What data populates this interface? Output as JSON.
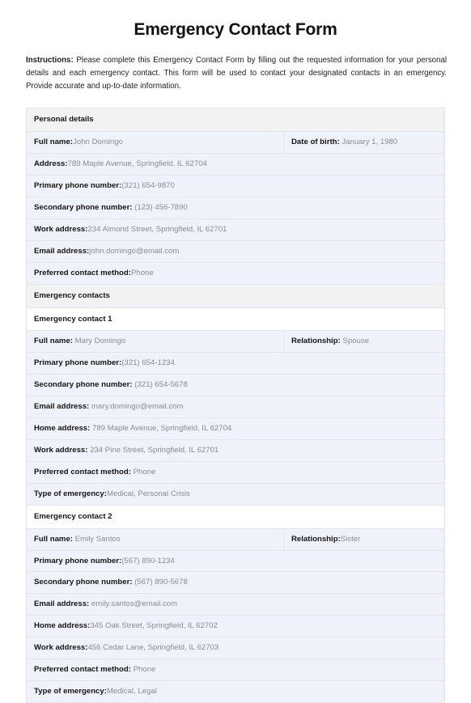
{
  "document": {
    "title": "Emergency Contact Form",
    "instructions_lead": "Instructions:",
    "instructions_body": " Please complete this Emergency Contact Form by filling out the requested information for your personal details and each emergency contact. This form will be used to contact your designated contacts in an emergency. Provide accurate and up-to-date information."
  },
  "colors": {
    "row_background": "#f0f2fb",
    "section_background": "#f1f2f3",
    "subsection_background": "#ffffff",
    "border": "#e4e5ea",
    "label_text": "#141414",
    "value_text": "#8b8b93"
  },
  "table": {
    "rows": [
      {
        "kind": "section",
        "cells": [
          {
            "label": "Personal details",
            "value": ""
          }
        ]
      },
      {
        "kind": "data",
        "split": true,
        "cells": [
          {
            "label": "Full name:",
            "value": "John Domingo"
          },
          {
            "label": "Date of birth:",
            "value": " January 1, 1980"
          }
        ]
      },
      {
        "kind": "data",
        "cells": [
          {
            "label": "Address:",
            "value": "789 Maple Avenue, Springfield, IL 62704"
          }
        ]
      },
      {
        "kind": "data",
        "cells": [
          {
            "label": "Primary phone number:",
            "value": "(321) 654-9870"
          }
        ]
      },
      {
        "kind": "data",
        "cells": [
          {
            "label": "Secondary phone number:",
            "value": " (123) 456-7890"
          }
        ]
      },
      {
        "kind": "data",
        "cells": [
          {
            "label": "Work address:",
            "value": "234 Almond Street, Springfield, IL 62701"
          }
        ]
      },
      {
        "kind": "data",
        "cells": [
          {
            "label": "Email address:",
            "value": "john.domingo@email.com"
          }
        ]
      },
      {
        "kind": "data",
        "cells": [
          {
            "label": "Preferred contact method:",
            "value": "Phone"
          }
        ]
      },
      {
        "kind": "section",
        "cells": [
          {
            "label": "Emergency contacts",
            "value": ""
          }
        ]
      },
      {
        "kind": "subsection",
        "cells": [
          {
            "label": "Emergency contact 1",
            "value": ""
          }
        ]
      },
      {
        "kind": "data",
        "split": true,
        "cells": [
          {
            "label": "Full name:",
            "value": " Mary Domingo"
          },
          {
            "label": "Relationship:",
            "value": " Spouse"
          }
        ]
      },
      {
        "kind": "data",
        "cells": [
          {
            "label": "Primary phone number:",
            "value": "(321) 654-1234"
          }
        ]
      },
      {
        "kind": "data",
        "cells": [
          {
            "label": "Secondary phone number:",
            "value": " (321) 654-5678"
          }
        ]
      },
      {
        "kind": "data",
        "cells": [
          {
            "label": "Email address:",
            "value": " mary.domingo@email.com"
          }
        ]
      },
      {
        "kind": "data",
        "cells": [
          {
            "label": "Home address:",
            "value": " 789 Maple Avenue, Springfield, IL 62704"
          }
        ]
      },
      {
        "kind": "data",
        "cells": [
          {
            "label": "Work address:",
            "value": " 234 Pine Street, Springfield, IL 62701"
          }
        ]
      },
      {
        "kind": "data",
        "cells": [
          {
            "label": "Preferred contact method:",
            "value": " Phone"
          }
        ]
      },
      {
        "kind": "data",
        "cells": [
          {
            "label": "Type of emergency:",
            "value": "Medical, Personal Crisis"
          }
        ]
      },
      {
        "kind": "subsection",
        "cells": [
          {
            "label": "Emergency contact 2",
            "value": ""
          }
        ]
      },
      {
        "kind": "data",
        "split": true,
        "cells": [
          {
            "label": "Full name:",
            "value": " Emily Santos"
          },
          {
            "label": "Relationship:",
            "value": "Sister"
          }
        ]
      },
      {
        "kind": "data",
        "cells": [
          {
            "label": "Primary phone number:",
            "value": "(567) 890-1234"
          }
        ]
      },
      {
        "kind": "data",
        "cells": [
          {
            "label": "Secondary phone number:",
            "value": " (567) 890-5678"
          }
        ]
      },
      {
        "kind": "data",
        "cells": [
          {
            "label": "Email address:",
            "value": " emily.santos@email.com"
          }
        ]
      },
      {
        "kind": "data",
        "cells": [
          {
            "label": "Home address:",
            "value": "345 Oak Street, Springfield, IL 62702"
          }
        ]
      },
      {
        "kind": "data",
        "cells": [
          {
            "label": "Work address:",
            "value": "456 Cedar Lane, Springfield, IL 62703"
          }
        ]
      },
      {
        "kind": "data",
        "cells": [
          {
            "label": "Preferred contact method:",
            "value": " Phone"
          }
        ]
      },
      {
        "kind": "data",
        "cells": [
          {
            "label": "Type of emergency:",
            "value": "Medical, Legal"
          }
        ]
      }
    ]
  }
}
